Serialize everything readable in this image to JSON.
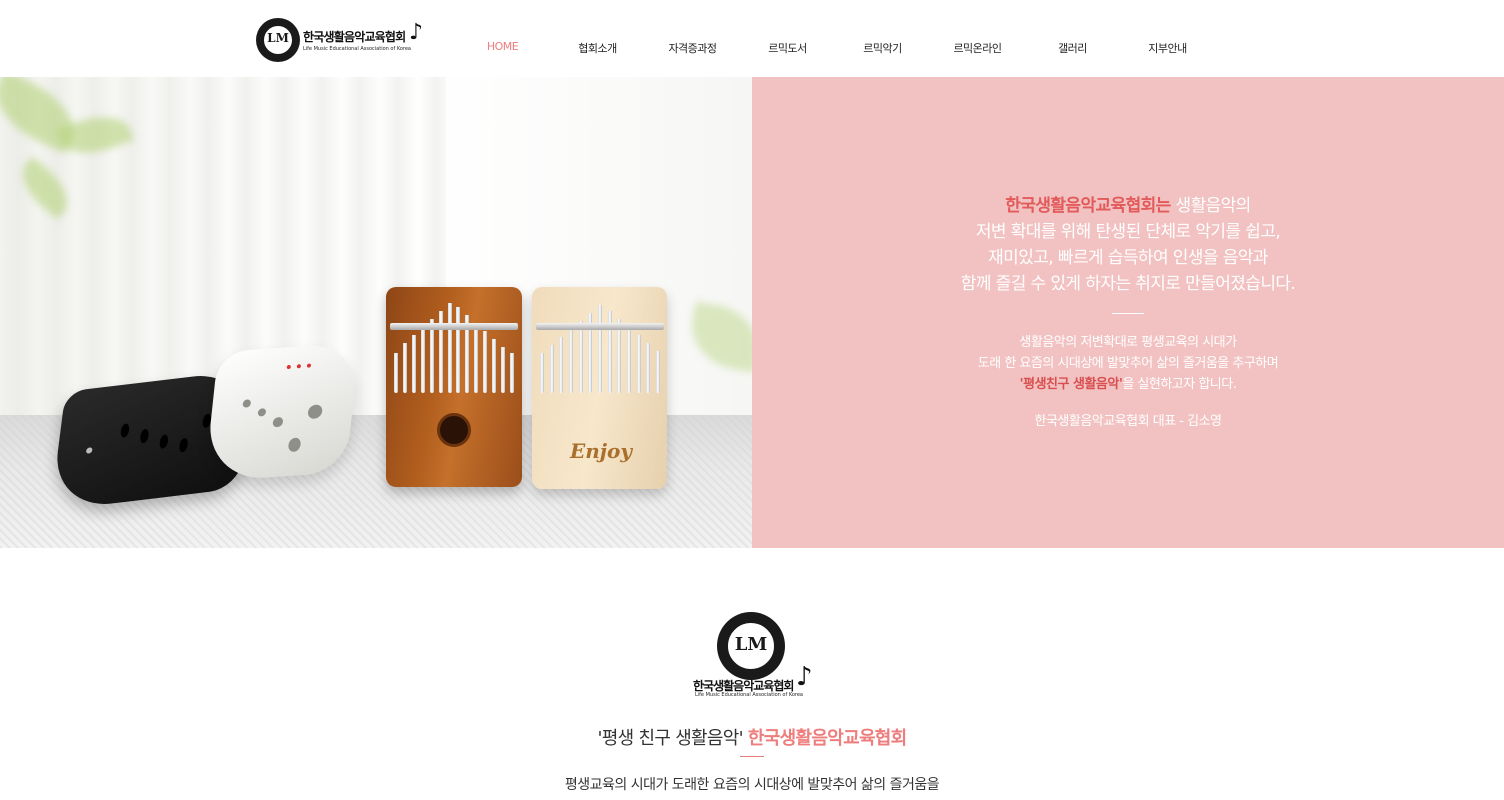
{
  "header": {
    "logo_mark": "LM",
    "logo_title": "한국생활음악교육협회",
    "logo_subtitle": "Life Music Educational Association of Korea",
    "nav": [
      {
        "label": "HOME"
      },
      {
        "label": "협회소개"
      },
      {
        "label": "자격증과정"
      },
      {
        "label": "르믹도서"
      },
      {
        "label": "르믹악기"
      },
      {
        "label": "르믹온라인"
      },
      {
        "label": "갤러리"
      },
      {
        "label": "지부안내"
      }
    ],
    "active_nav": "HOME",
    "accent_color": "#ee7d7d"
  },
  "hero": {
    "panel_color": "#f2c2c2",
    "line1_accent": "한국생활음악교육협회는",
    "line1_rest": " 생활음악의",
    "line2": "저변 확대를 위해 탄생된 단체로 악기를 쉽고,",
    "line3": "재미있고, 빠르게 습득하여 인생을 음악과",
    "line4": "함께 즐길 수 있게 하자는 취지로 만들어졌습니다.",
    "small1": "생활음악의 저변확대로 평생교육의 시대가",
    "small2": "도래 한 요즘의 시대상에 발맞추어 삶의 즐거움을 추구하며",
    "small3_accent": "'평생친구 생활음악'",
    "small3_rest": "을 실현하고자 합니다.",
    "ceo": "한국생활음악교육협회 대표 - 김소영",
    "kalimba_brand": "Enjoy"
  },
  "intro": {
    "logo_mark": "LM",
    "logo_title": "한국생활음악교육협회",
    "logo_subtitle": "Life Music Educational Association of Korea",
    "slogan_quote": "'평생 친구 생활음악'",
    "slogan_name": "한국생활음악교육협회",
    "body_line1": "평생교육의 시대가 도래한 요즘의 시대상에 발맞추어 삶의 즐거움을"
  }
}
